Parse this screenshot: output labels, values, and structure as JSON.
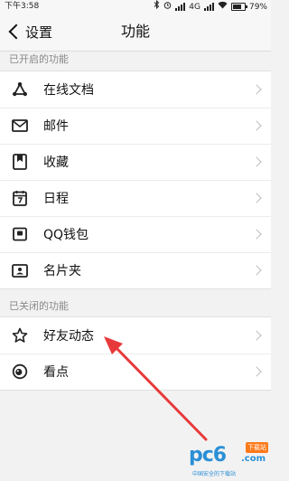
{
  "status_bar": {
    "time": "下午3:58",
    "network": "4G",
    "battery_text": "79%",
    "battery_level": 0.79
  },
  "nav": {
    "back_label": "设置",
    "title": "功能"
  },
  "sections": {
    "enabled_header": "已开启的功能",
    "enabled_items": [
      {
        "label": "在线文档",
        "icon": "online-doc-icon"
      },
      {
        "label": "邮件",
        "icon": "mail-icon"
      },
      {
        "label": "收藏",
        "icon": "favorites-icon"
      },
      {
        "label": "日程",
        "icon": "calendar-icon"
      },
      {
        "label": "QQ钱包",
        "icon": "wallet-icon"
      },
      {
        "label": "名片夹",
        "icon": "business-card-icon"
      }
    ],
    "disabled_header": "已关闭的功能",
    "disabled_items": [
      {
        "label": "好友动态",
        "icon": "star-icon"
      },
      {
        "label": "看点",
        "icon": "eye-icon"
      }
    ]
  },
  "watermark": {
    "logo_text": "pc6",
    "domain_text": ".com",
    "badge_text": "下载站",
    "slogan": "中国安全的下载站"
  },
  "colors": {
    "annotation_arrow": "#e8393a",
    "watermark_blue": "#2a8fd6",
    "watermark_orange": "#ff7a1a"
  }
}
